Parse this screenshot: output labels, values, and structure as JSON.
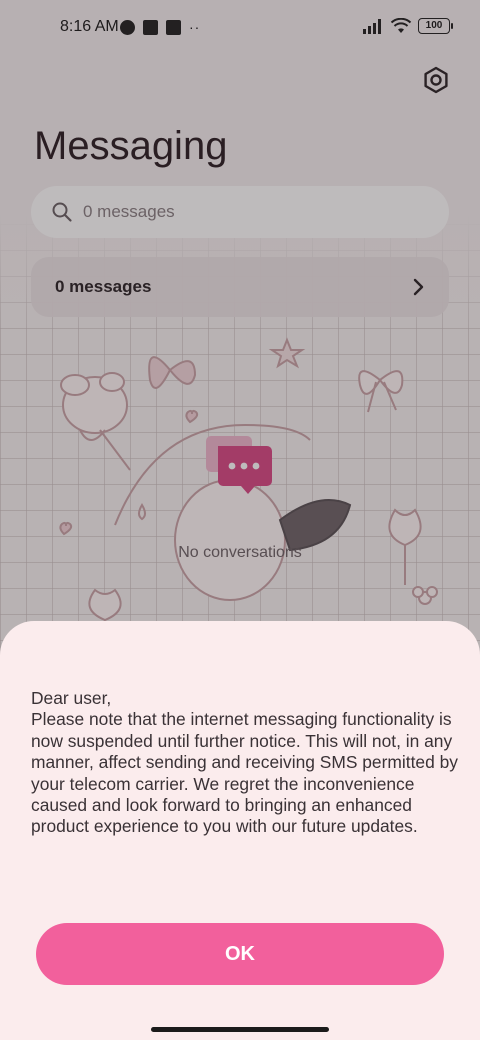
{
  "status_bar": {
    "time": "8:16 AM",
    "left_icons": [
      "circle-app-icon",
      "square-app-icon",
      "upload-app-icon"
    ],
    "more": "··",
    "battery": "100"
  },
  "header": {
    "title": "Messaging",
    "settings_icon": "gear-icon"
  },
  "search": {
    "placeholder": "0 messages",
    "value": ""
  },
  "messages_row": {
    "label": "0 messages"
  },
  "empty_state": {
    "text": "No conversations",
    "icon": "chat-bubble-icon",
    "accent": "#d94a86"
  },
  "dialog": {
    "message": "Dear user,\nPlease note that the internet messaging functionality is now suspended until further notice. This will not, in any manner, affect sending and receiving SMS permitted by your telecom carrier. We regret the inconvenience caused and look forward to bringing an enhanced product experience to you with our future updates.",
    "ok_label": "OK",
    "accent": "#f2609c",
    "background": "#fbeced"
  }
}
